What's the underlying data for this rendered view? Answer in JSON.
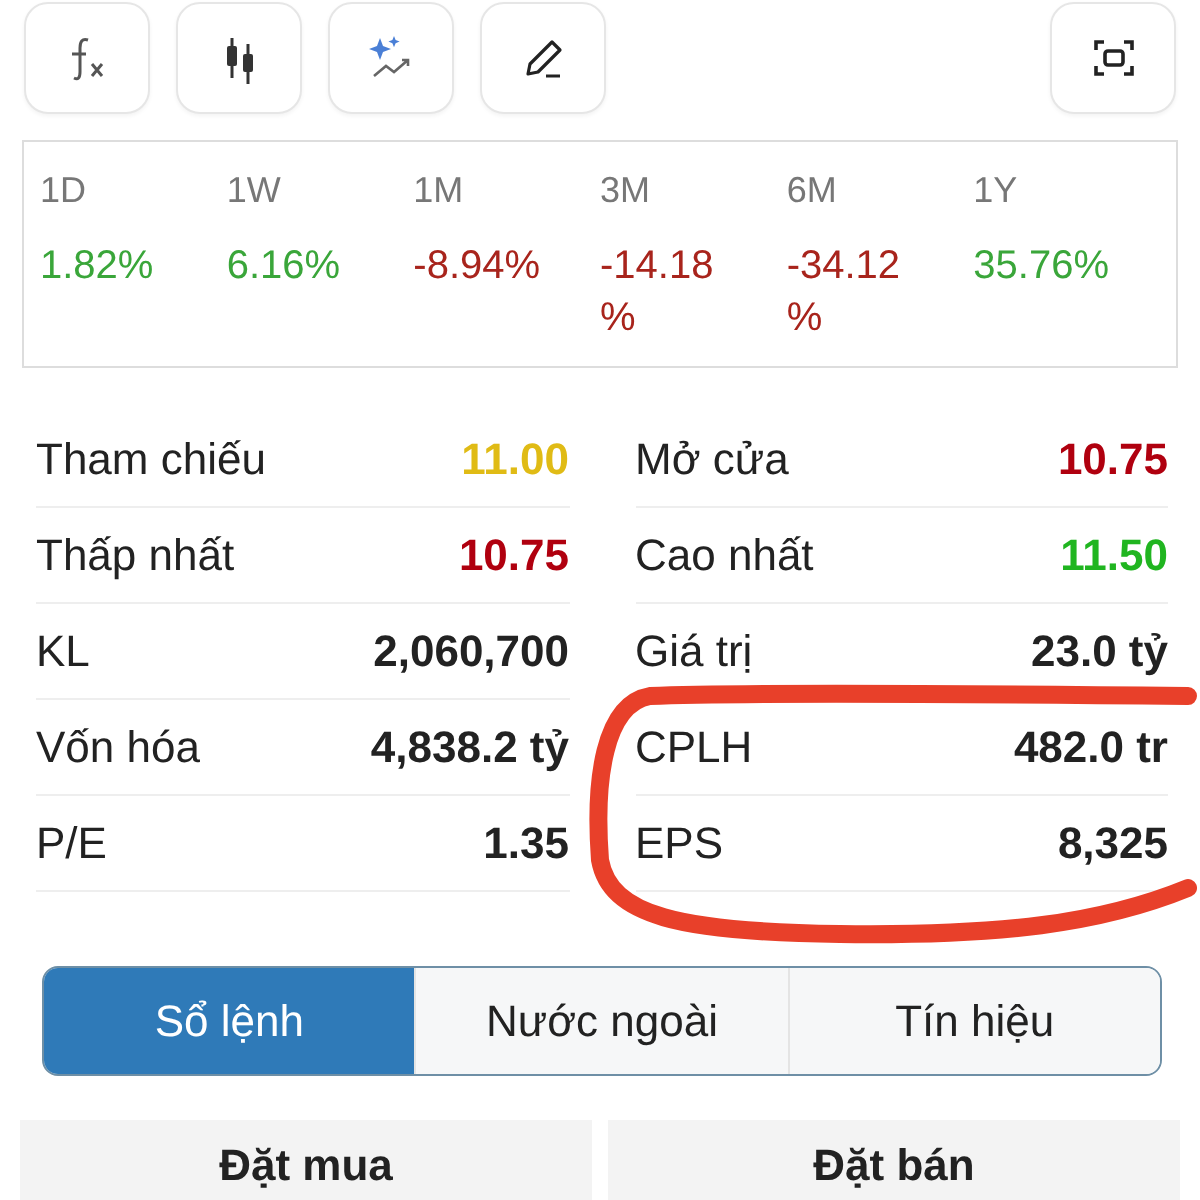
{
  "periods": [
    {
      "label": "1D",
      "change": "1.82%",
      "color": "#3aa63a"
    },
    {
      "label": "1W",
      "change": "6.16%",
      "color": "#3aa63a"
    },
    {
      "label": "1M",
      "change": "-8.94%",
      "color": "#a8241c"
    },
    {
      "label": "3M",
      "change": "-14.18%",
      "color": "#a8241c"
    },
    {
      "label": "6M",
      "change": "-34.12%",
      "color": "#a8241c"
    },
    {
      "label": "1Y",
      "change": "35.76%",
      "color": "#3aa63a"
    }
  ],
  "stats_left": [
    {
      "label": "Tham chiếu",
      "value": "11.00",
      "color": "#e0bb15"
    },
    {
      "label": "Thấp nhất",
      "value": "10.75",
      "color": "#b0000f"
    },
    {
      "label": "KL",
      "value": "2,060,700",
      "color": "#222222"
    },
    {
      "label": "Vốn hóa",
      "value": "4,838.2 tỷ",
      "color": "#222222"
    },
    {
      "label": "P/E",
      "value": "1.35",
      "color": "#222222"
    }
  ],
  "stats_right": [
    {
      "label": "Mở cửa",
      "value": "10.75",
      "color": "#b0000f"
    },
    {
      "label": "Cao nhất",
      "value": "11.50",
      "color": "#20b520"
    },
    {
      "label": "Giá trị",
      "value": "23.0 tỷ",
      "color": "#222222"
    },
    {
      "label": "CPLH",
      "value": "482.0 tr",
      "color": "#222222"
    },
    {
      "label": "EPS",
      "value": "8,325",
      "color": "#222222"
    }
  ],
  "tabs": [
    {
      "label": "Sổ lệnh",
      "selected": true
    },
    {
      "label": "Nước ngoài",
      "selected": false
    },
    {
      "label": "Tín hiệu",
      "selected": false
    }
  ],
  "order_sides": [
    "Đặt mua",
    "Đặt bán"
  ]
}
